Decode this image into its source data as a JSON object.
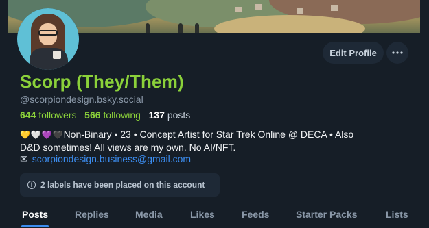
{
  "profile": {
    "display_name": "Scorp (They/Them)",
    "handle": "@scorpiondesign.bsky.social",
    "followers_count": "644",
    "followers_label": "followers",
    "following_count": "566",
    "following_label": "following",
    "posts_count": "137",
    "posts_label": "posts",
    "bio_hearts": [
      "💛",
      "🤍",
      "💜",
      "🖤"
    ],
    "bio_line1": "Non-Binary • 23 • Concept Artist for Star Trek Online @ DECA • Also",
    "bio_line2": "D&D sometimes! All views are my own. No AI/NFT.",
    "email": "scorpiondesign.business@gmail.com",
    "labels_notice": "2 labels have been placed on this account"
  },
  "actions": {
    "edit_profile_label": "Edit Profile",
    "more_icon": "ellipsis-icon"
  },
  "tabs": [
    {
      "label": "Posts",
      "active": true
    },
    {
      "label": "Replies"
    },
    {
      "label": "Media"
    },
    {
      "label": "Likes"
    },
    {
      "label": "Feeds"
    },
    {
      "label": "Starter Packs"
    },
    {
      "label": "Lists"
    }
  ],
  "colors": {
    "background": "#161e27",
    "name_green": "#8bd13a",
    "link_blue": "#3c8df0",
    "muted": "#8a98a8",
    "button_bg": "#1e2936"
  }
}
